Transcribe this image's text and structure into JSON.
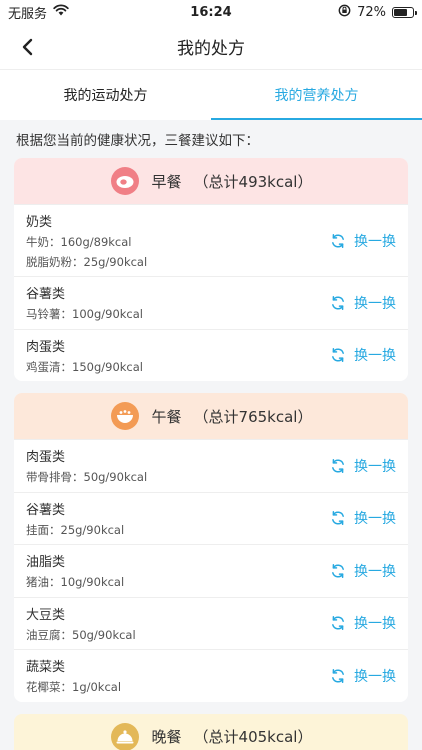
{
  "status": {
    "carrier": "无服务",
    "time": "16:24",
    "battery": "72%",
    "battery_level": 0.72
  },
  "header": {
    "title": "我的处方"
  },
  "tabs": [
    {
      "label": "我的运动处方",
      "active": false
    },
    {
      "label": "我的营养处方",
      "active": true
    }
  ],
  "intro": "根据您当前的健康状况，三餐建议如下：",
  "swap_label": "换一换",
  "colors": {
    "accent": "#27a9e1",
    "breakfast_bg": "#fde4e4",
    "lunch_bg": "#fde8da",
    "dinner_bg": "#fdf4d8"
  },
  "meals": [
    {
      "name": "早餐",
      "total": "（总计493kcal）",
      "items": [
        {
          "category": "奶类",
          "details": [
            "牛奶：160g/89kcal",
            "脱脂奶粉：25g/90kcal"
          ]
        },
        {
          "category": "谷薯类",
          "details": [
            "马铃薯：100g/90kcal"
          ]
        },
        {
          "category": "肉蛋类",
          "details": [
            "鸡蛋清：150g/90kcal"
          ]
        }
      ]
    },
    {
      "name": "午餐",
      "total": "（总计765kcal）",
      "items": [
        {
          "category": "肉蛋类",
          "details": [
            "带骨排骨：50g/90kcal"
          ]
        },
        {
          "category": "谷薯类",
          "details": [
            "挂面：25g/90kcal"
          ]
        },
        {
          "category": "油脂类",
          "details": [
            "猪油：10g/90kcal"
          ]
        },
        {
          "category": "大豆类",
          "details": [
            "油豆腐：50g/90kcal"
          ]
        },
        {
          "category": "蔬菜类",
          "details": [
            "花椰菜：1g/0kcal"
          ]
        }
      ]
    },
    {
      "name": "晚餐",
      "total": "（总计405kcal）",
      "items": []
    }
  ]
}
